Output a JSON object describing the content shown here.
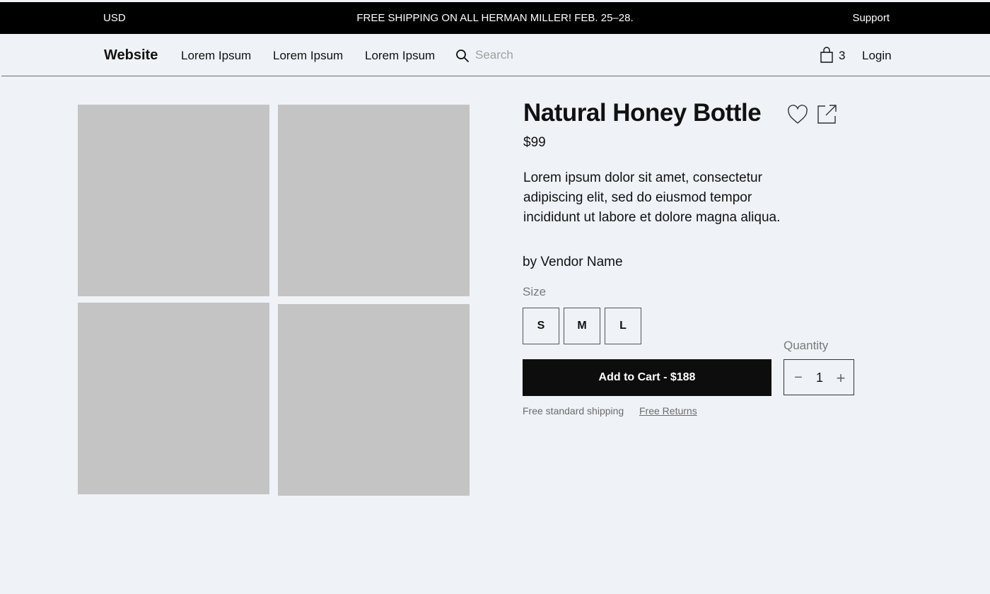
{
  "topbar": {
    "currency": "USD",
    "promo": "FREE SHIPPING ON ALL HERMAN MILLER! FEB. 25–28.",
    "support": "Support"
  },
  "nav": {
    "logo": "Website",
    "links": [
      "Lorem Ipsum",
      "Lorem Ipsum",
      "Lorem Ipsum"
    ],
    "search_placeholder": "Search",
    "cart_count": "3",
    "login": "Login"
  },
  "product": {
    "title": "Natural Honey Bottle",
    "price": "$99",
    "description": "Lorem ipsum dolor sit amet, consectetur adipiscing elit, sed do eiusmod tempor incididunt ut labore et dolore magna aliqua.",
    "vendor": "by Vendor Name",
    "size_label": "Size",
    "sizes": [
      "S",
      "M",
      "L"
    ],
    "add_to_cart": "Add to Cart - $188",
    "quantity_label": "Quantity",
    "quantity": "1",
    "qty_minus": "−",
    "qty_plus": "+",
    "shipping_note": "Free standard shipping",
    "returns_link": "Free Returns"
  },
  "icons": {
    "search": "search-icon",
    "cart": "shopping-bag-icon",
    "favorite": "heart-icon",
    "share": "share-icon"
  },
  "colors": {
    "background": "#eff2f7",
    "topbar": "#000000",
    "primary_button": "#0d0d0d",
    "image_placeholder": "#c4c4c4"
  }
}
